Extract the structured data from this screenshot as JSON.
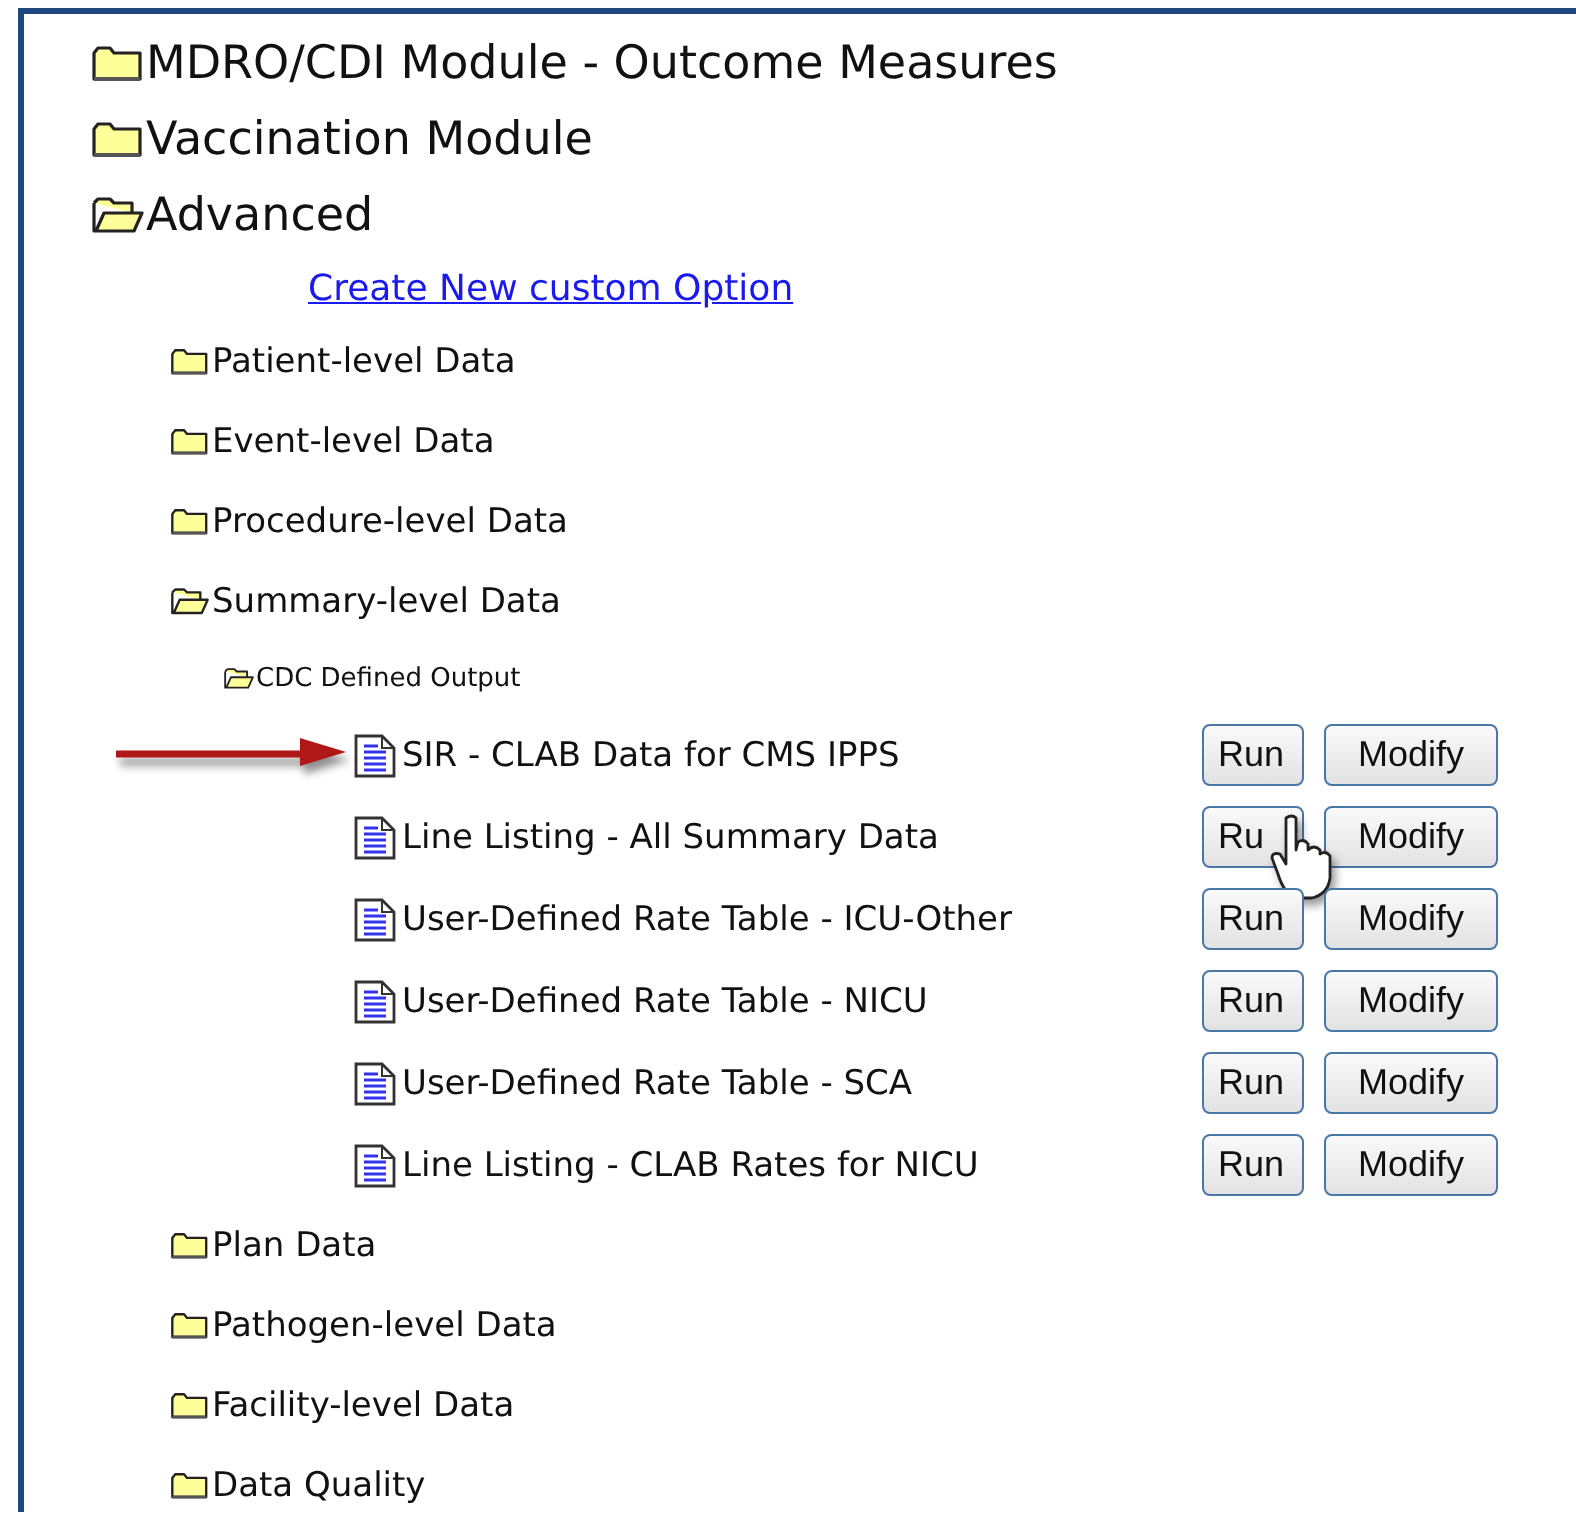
{
  "tree": [
    {
      "kind": "folder",
      "label": "MDRO/CDI Module - Outcome Measures",
      "expanded": false
    },
    {
      "kind": "folder",
      "label": "Vaccination Module",
      "expanded": false
    },
    {
      "kind": "folder",
      "label": "Advanced",
      "expanded": true,
      "children": [
        {
          "kind": "link",
          "label": "Create New custom Option"
        },
        {
          "kind": "folder",
          "label": "Patient-level Data",
          "expanded": false
        },
        {
          "kind": "folder",
          "label": "Event-level Data",
          "expanded": false
        },
        {
          "kind": "folder",
          "label": "Procedure-level Data",
          "expanded": false
        },
        {
          "kind": "folder",
          "label": "Summary-level Data",
          "expanded": true,
          "children": [
            {
              "kind": "folder",
              "label": "CDC Defined Output",
              "expanded": true,
              "children": [
                {
                  "kind": "report",
                  "label": "SIR - CLAB Data for CMS IPPS",
                  "marked": true,
                  "buttons": [
                    {
                      "label": "Run",
                      "hovered": false
                    },
                    {
                      "label": "Modify",
                      "hovered": false
                    }
                  ]
                },
                {
                  "kind": "report",
                  "label": "Line Listing - All Summary Data",
                  "marked": false,
                  "buttons": [
                    {
                      "label": "Ru",
                      "hovered": true
                    },
                    {
                      "label": "Modify",
                      "hovered": false
                    }
                  ]
                },
                {
                  "kind": "report",
                  "label": "User-Defined Rate Table - ICU-Other",
                  "marked": false,
                  "buttons": [
                    {
                      "label": "Run",
                      "hovered": false
                    },
                    {
                      "label": "Modify",
                      "hovered": false
                    }
                  ]
                },
                {
                  "kind": "report",
                  "label": "User-Defined Rate Table - NICU",
                  "marked": false,
                  "buttons": [
                    {
                      "label": "Run",
                      "hovered": false
                    },
                    {
                      "label": "Modify",
                      "hovered": false
                    }
                  ]
                },
                {
                  "kind": "report",
                  "label": "User-Defined Rate Table - SCA",
                  "marked": false,
                  "buttons": [
                    {
                      "label": "Run",
                      "hovered": false
                    },
                    {
                      "label": "Modify",
                      "hovered": false
                    }
                  ]
                },
                {
                  "kind": "report",
                  "label": "Line Listing - CLAB Rates for NICU",
                  "marked": false,
                  "buttons": [
                    {
                      "label": "Run",
                      "hovered": false
                    },
                    {
                      "label": "Modify",
                      "hovered": false
                    }
                  ]
                }
              ]
            }
          ]
        },
        {
          "kind": "folder",
          "label": "Plan Data",
          "expanded": false
        },
        {
          "kind": "folder",
          "label": "Pathogen-level Data",
          "expanded": false
        },
        {
          "kind": "folder",
          "label": "Facility-level Data",
          "expanded": false
        },
        {
          "kind": "folder",
          "label": "Data Quality",
          "expanded": false
        }
      ]
    }
  ]
}
